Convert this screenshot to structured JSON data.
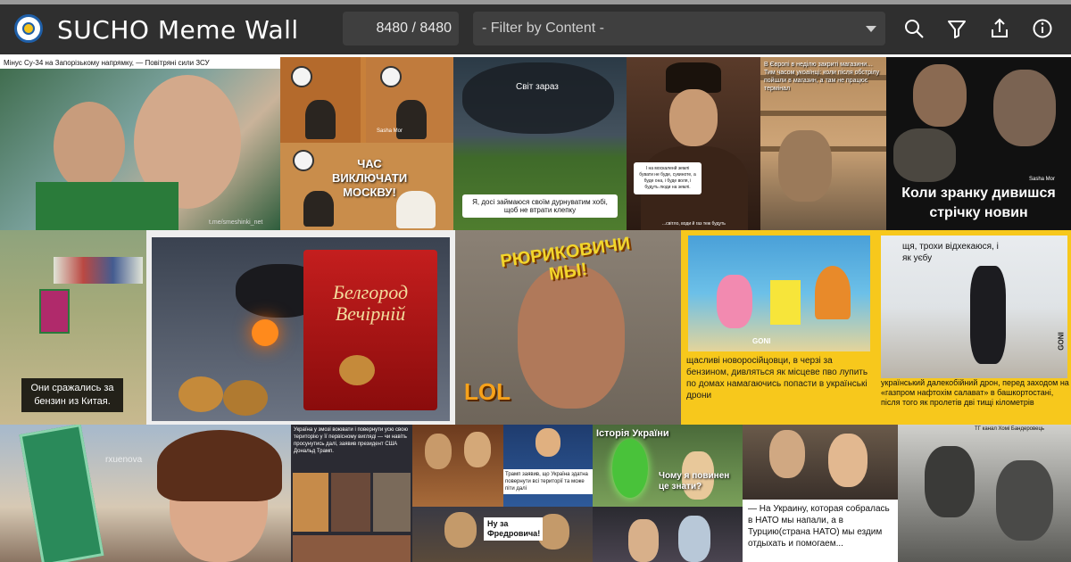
{
  "app": {
    "title": "SUCHO Meme Wall",
    "counter": "8480 / 8480",
    "filter_placeholder": "- Filter by Content -"
  },
  "toolbar": {
    "icons": [
      "search-icon",
      "filter-icon",
      "share-icon",
      "info-icon"
    ]
  },
  "colors": {
    "header_bg": "#2f2f2f",
    "control_bg": "#3f3f3f",
    "yellow_frame": "#f7c81c"
  },
  "memes": {
    "m1": {
      "caption": "Мінус Су-34 на Запорізькому напрямку, — Повітряні сили ЗСУ",
      "watermark": "t.me/smeshinki_net"
    },
    "m2": {
      "caption": "ЧАС ВИКЛЮЧАТИ МОСКВУ!",
      "watermark": "Sasha Mor"
    },
    "m3": {
      "top_text": "Світ зараз",
      "caption": "Я, досі займаюся своїм дурнуватим хобі, щоб не втрати клепку"
    },
    "m4": {
      "caption": "І на москаленй землі бувати не буде, сукиноте, а буде она, і буде воля, і будуть люди на землі.",
      "footer": "...світло, води й газ теж будуть"
    },
    "m5": {
      "caption": "В Європі в неділю закриті магазини… Тим часом укоаїнці: коли після обстрілу пойшли в магазин, а там не працює термінал"
    },
    "m6": {
      "caption": "Коли зранку дивишся стрічку новин",
      "watermark": "Sasha Mor"
    },
    "m7": {
      "caption": "Они сражались за бензин из Китая."
    },
    "m8": {
      "brand": "Белгород Вечірній"
    },
    "m9": {
      "top_text": "РЮРИКОВИЧИ МЫ!",
      "sticker": "LOL"
    },
    "m10": {
      "caption": "щасливі новоросійцовци, в черзі за бензином, дивляться як місцеве пво лупить по домах намагаючись попасти в українські дрони",
      "watermark": "GONI"
    },
    "m11": {
      "top_text": "щя, трохи відхекаюся, і як уєбу",
      "caption": "український далекобійний дрон, перед заходом на «газпром нафтохім салават» в башкортостані, після того як пролетів дві тищі кілометрів",
      "watermark": "GONI"
    },
    "m12": {
      "watermark": "rxuenova"
    },
    "m13": {
      "caption": "Україна у змозі воювати і повернути усю свою територію у її первісному вигляді — чи навіть просунутись далі, заявив президент США Дональд Трамп."
    },
    "m14": {
      "caption": "Трамп заявив, що Україна здатна повернути всі території та може піти далі"
    },
    "m15": {
      "caption": "Ну за Фредровича!"
    },
    "m16": {
      "title": "Історія України",
      "caption": "Чому я повинен це знати?"
    },
    "m17": {
      "caption": "— На Украину, которая собралась в НАТО мы напали, а в Турцию(страна НАТО) мы ездим отдыхать и помогаем..."
    },
    "m18": {
      "watermark": "ТГ канал Хомі Бандеровець"
    }
  }
}
